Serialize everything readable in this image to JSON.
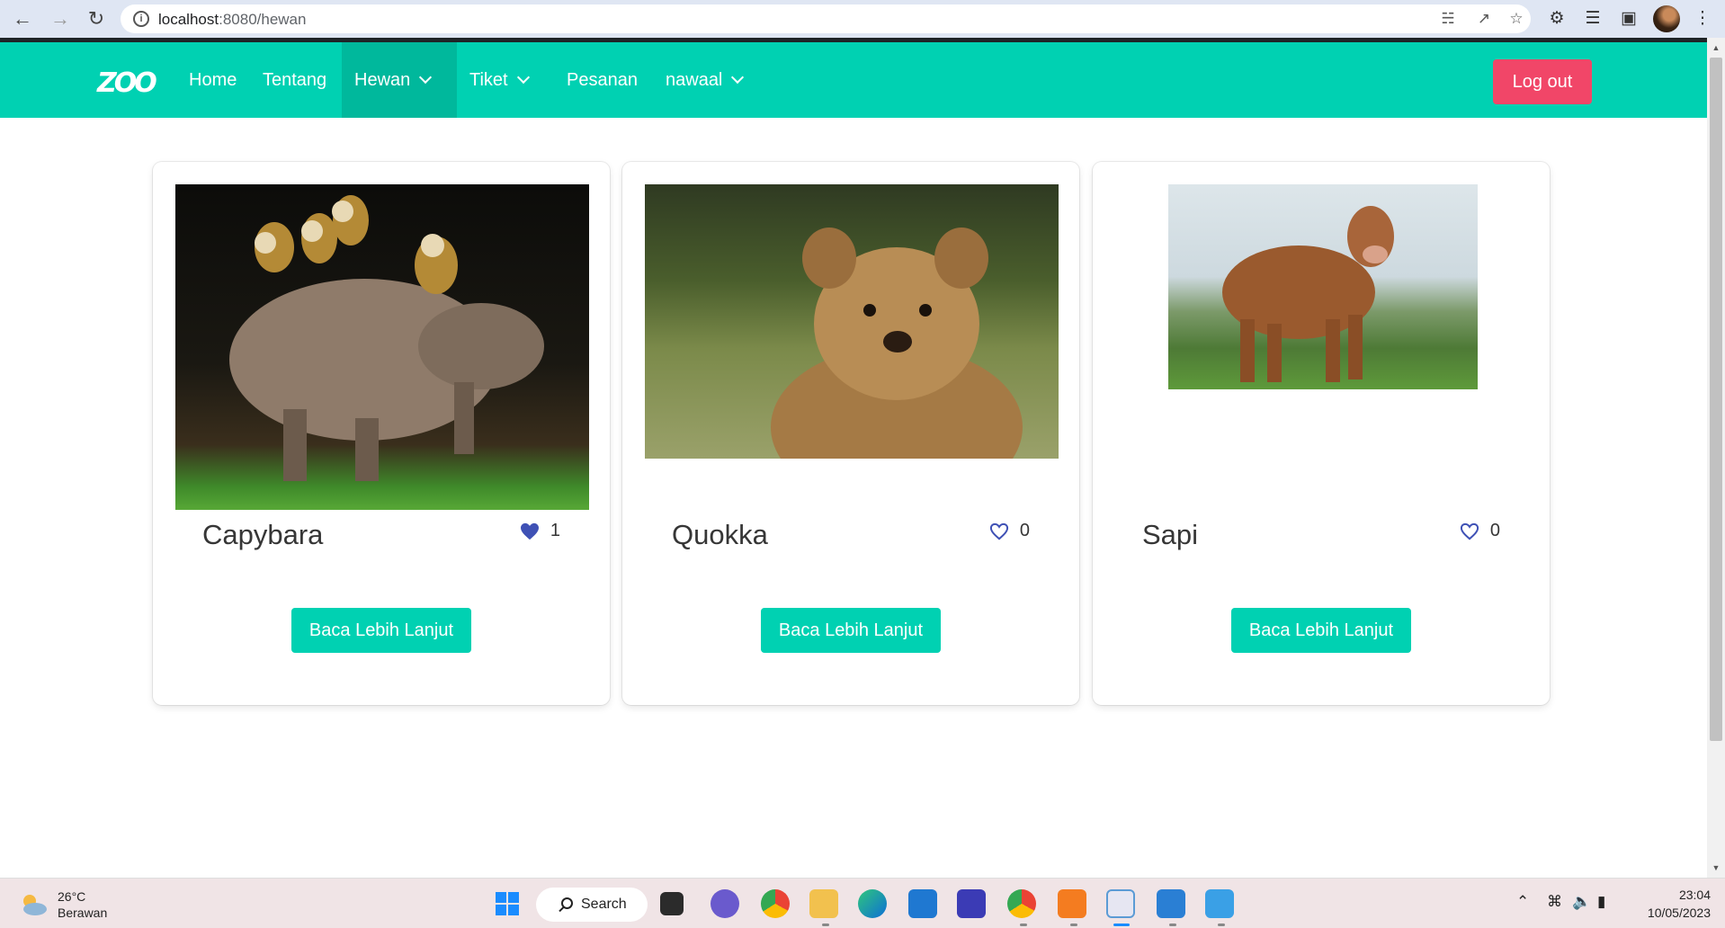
{
  "browser": {
    "url_host": "localhost",
    "url_path": ":8080/hewan"
  },
  "navbar": {
    "logo": "ZOO",
    "items": [
      {
        "label": "Home"
      },
      {
        "label": "Tentang"
      },
      {
        "label": "Hewan"
      },
      {
        "label": "Tiket"
      },
      {
        "label": "Pesanan"
      },
      {
        "label": "nawaal"
      }
    ],
    "logout_label": "Log out"
  },
  "cards": [
    {
      "name": "Capybara",
      "likes": "1",
      "liked": true,
      "button": "Baca Lebih Lanjut"
    },
    {
      "name": "Quokka",
      "likes": "0",
      "liked": false,
      "button": "Baca Lebih Lanjut"
    },
    {
      "name": "Sapi",
      "likes": "0",
      "liked": false,
      "button": "Baca Lebih Lanjut"
    }
  ],
  "taskbar": {
    "weather_temp": "26°C",
    "weather_desc": "Berawan",
    "search_label": "Search",
    "time": "23:04",
    "date": "10/05/2023"
  },
  "colors": {
    "primary": "#00d1b2",
    "danger": "#f14668",
    "heart": "#3f51b5"
  }
}
